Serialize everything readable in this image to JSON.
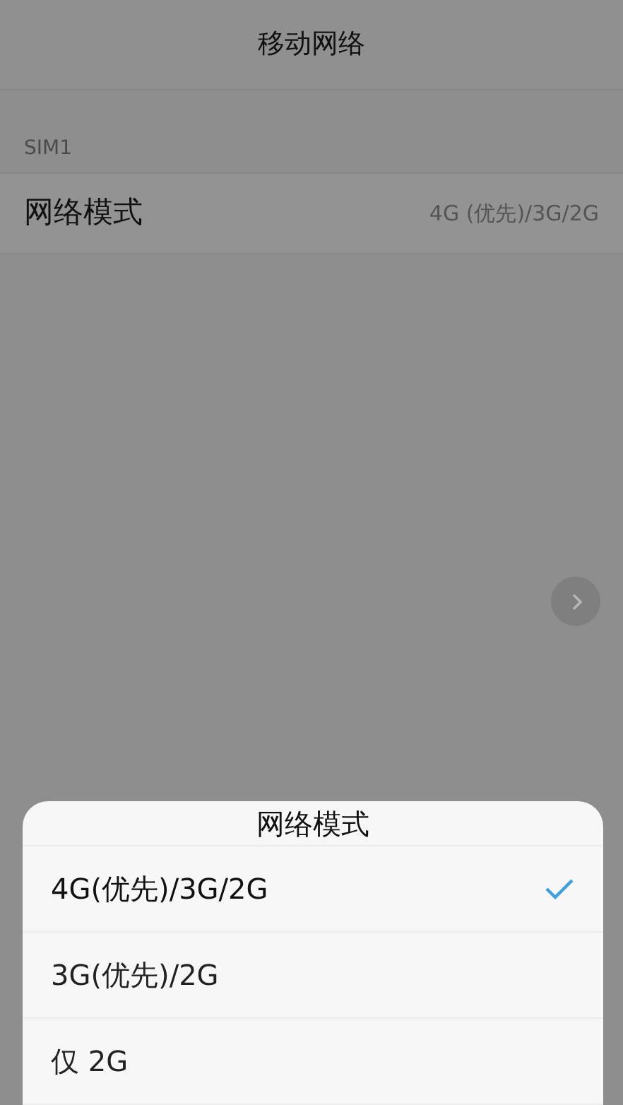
{
  "header": {
    "title": "移动网络"
  },
  "section": {
    "label": "SIM1"
  },
  "setting": {
    "label": "网络模式",
    "value": "4G (优先)/3G/2G"
  },
  "sheet": {
    "title": "网络模式",
    "options": [
      {
        "label": "4G(优先)/3G/2G",
        "selected": true
      },
      {
        "label": "3G(优先)/2G",
        "selected": false
      },
      {
        "label": "仅 2G",
        "selected": false
      }
    ]
  }
}
